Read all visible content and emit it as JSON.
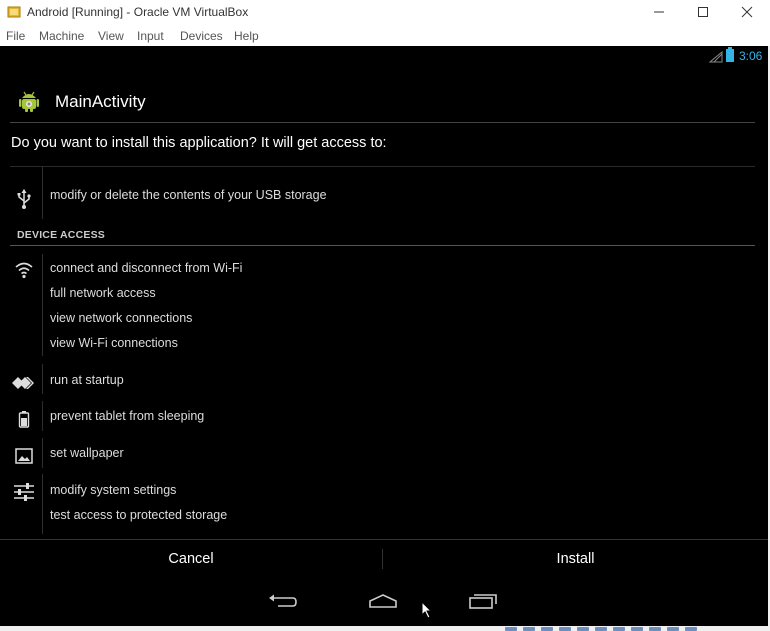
{
  "window": {
    "title": "Android [Running] - Oracle VM VirtualBox"
  },
  "menubar": {
    "items": [
      "File",
      "Machine",
      "View",
      "Input",
      "Devices",
      "Help"
    ]
  },
  "statusbar": {
    "time": "3:06"
  },
  "actionbar": {
    "title": "MainActivity"
  },
  "dialog": {
    "question": "Do you want to install this application? It will get access to:",
    "section_title": "DEVICE ACCESS",
    "permissions_storage": [
      "modify or delete the contents of your USB storage"
    ],
    "permissions_network": [
      "connect and disconnect from Wi-Fi",
      "full network access",
      "view network connections",
      "view Wi-Fi connections"
    ],
    "permission_startup": "run at startup",
    "permission_sleep": "prevent tablet from sleeping",
    "permission_wallpaper": "set wallpaper",
    "permissions_system": [
      "modify system settings",
      "test access to protected storage"
    ]
  },
  "buttons": {
    "cancel": "Cancel",
    "install": "Install"
  },
  "icons": {
    "usb": "usb-icon",
    "wifi": "wifi-icon",
    "startup": "startup-icon",
    "sleep": "battery-icon",
    "wallpaper": "wallpaper-icon",
    "settings": "sliders-icon",
    "back": "back-icon",
    "home": "home-icon",
    "recents": "recents-icon"
  },
  "colors": {
    "holo_blue": "#33b5e5",
    "screen_bg": "#000000"
  }
}
